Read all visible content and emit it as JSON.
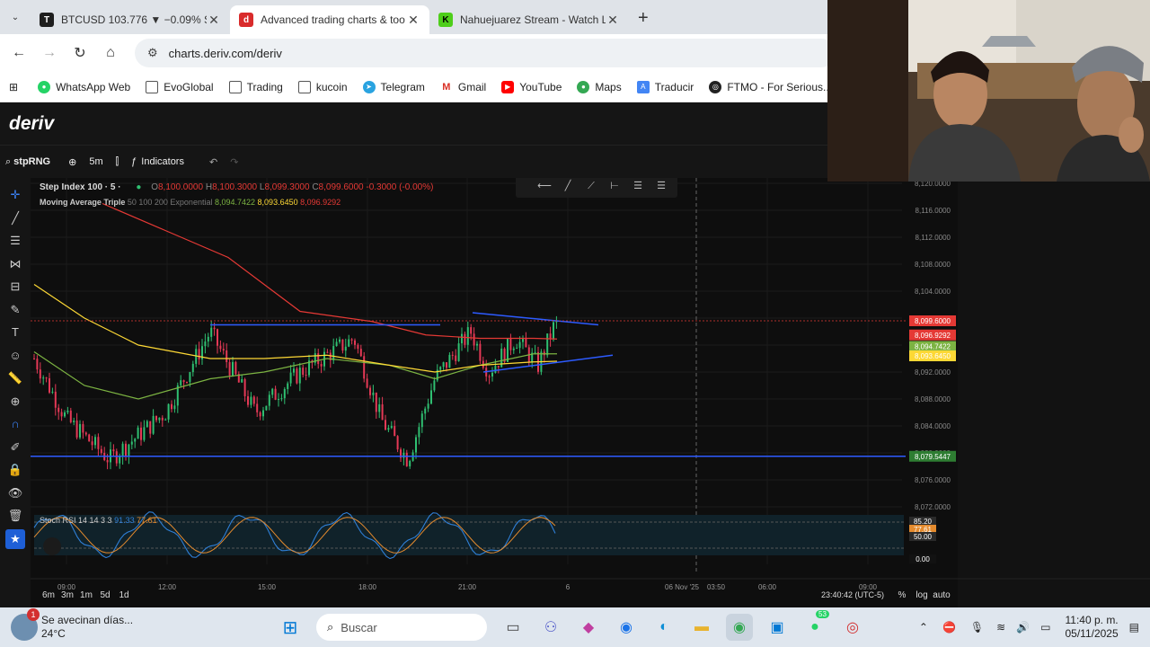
{
  "tabs": [
    {
      "title": "BTCUSD 103.776 ▼ −0.09% Sin",
      "color": "#1e1e1e",
      "glyph": "T"
    },
    {
      "title": "Advanced trading charts & too",
      "color": "#d92b2b",
      "glyph": "d",
      "active": true
    },
    {
      "title": "Nahuejuarez Stream - Watch Li",
      "color": "#4ece1a",
      "glyph": "K"
    }
  ],
  "address": "charts.deriv.com/deriv",
  "bookmarks": [
    {
      "label": "WhatsApp Web",
      "color": "#25d366"
    },
    {
      "label": "EvoGlobal",
      "color": "folder"
    },
    {
      "label": "Trading",
      "color": "folder"
    },
    {
      "label": "kucoin",
      "color": "folder"
    },
    {
      "label": "Telegram",
      "color": "#2aa3e0"
    },
    {
      "label": "Gmail",
      "color": "#d93025"
    },
    {
      "label": "YouTube",
      "color": "#ff0000"
    },
    {
      "label": "Maps",
      "color": "#34a853"
    },
    {
      "label": "Traducir",
      "color": "#4285f4"
    },
    {
      "label": "FTMO - For Serious...",
      "color": "#222222"
    }
  ],
  "app": {
    "logo": "deriv",
    "symbol": "stpRNG",
    "interval": "5m",
    "indicators_label": "Indicators",
    "legend": {
      "name": "Step Index 100 · 5 ·",
      "o": "8,100.0000",
      "h": "8,100.3000",
      "l": "8,099.3000",
      "c": "8,099.6000",
      "chg": "-0.3000 (-0.00%)"
    },
    "ma": {
      "label": "Moving Average Triple",
      "params": "50 100 200 Exponential",
      "v1": "8,094.7422",
      "v2": "8,093.6450",
      "v3": "8,096.9292"
    },
    "price_axis": [
      "8,120.0000",
      "8,116.0000",
      "8,112.0000",
      "8,108.0000",
      "8,104.0000",
      "8,100.0000",
      "8,096.0000",
      "8,092.0000",
      "8,088.0000",
      "8,084.0000",
      "8,080.0000",
      "8,076.0000",
      "8,072.0000"
    ],
    "price_tags": [
      {
        "label": "8,099.6000",
        "color": "#e53935"
      },
      {
        "label": "8,096.9292",
        "color": "#e53935"
      },
      {
        "label": "8,094.7422",
        "color": "#7cb342"
      },
      {
        "label": "8,093.6450",
        "color": "#fdd835"
      },
      {
        "label": "8,079.5447",
        "color": "#2e7d32"
      }
    ],
    "stoch": {
      "label": "Stoch RSI",
      "params": "14 14 3 3",
      "k": "91.33",
      "d": "77.61",
      "tags": [
        "85.20",
        "77.61",
        "50.00",
        "0.00"
      ]
    },
    "time_axis": [
      "09:00",
      "12:00",
      "15:00",
      "18:00",
      "21:00",
      "6",
      "06 Nov '25",
      "03:50",
      "06:00",
      "09:00"
    ],
    "timeframes": [
      "6m",
      "3m",
      "1m",
      "5d",
      "1d"
    ],
    "clock": "23:40:42 (UTC-5)",
    "axis_opts": [
      "%",
      "log",
      "auto"
    ]
  },
  "taskbar": {
    "weather_title": "Se avecinan días...",
    "weather_temp": "24°C",
    "weather_badge": "1",
    "search_placeholder": "Buscar",
    "whatsapp_badge": "53",
    "time": "11:40 p. m.",
    "date": "05/11/2025"
  }
}
